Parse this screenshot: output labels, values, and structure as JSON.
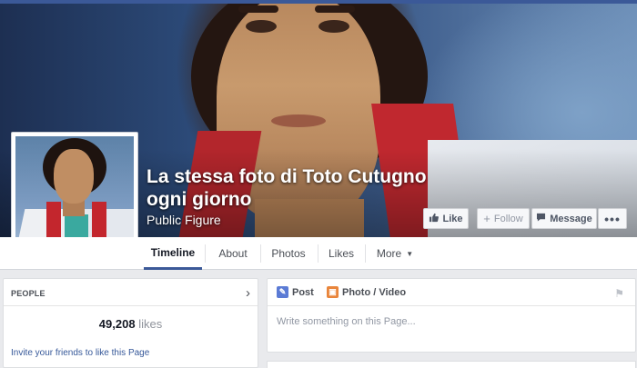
{
  "page": {
    "title": "La stessa foto di Toto Cutugno ogni giorno",
    "category": "Public Figure"
  },
  "actions": {
    "like": "Like",
    "follow": "Follow",
    "message": "Message",
    "more": "•••"
  },
  "tabs": [
    "Timeline",
    "About",
    "Photos",
    "Likes",
    "More"
  ],
  "people": {
    "title": "PEOPLE",
    "likes_count": "49,208",
    "likes_suffix": "likes",
    "invite": "Invite your friends to like this Page"
  },
  "composer": {
    "post_tab": "Post",
    "photo_tab": "Photo / Video",
    "placeholder": "Write something on this Page..."
  },
  "colors": {
    "brand": "#3b5998",
    "link": "#365899"
  },
  "icons": {
    "like": "thumbs-up-icon",
    "follow": "plus-icon",
    "message": "speech-bubble-icon",
    "people_chevron": "chevron-right-icon",
    "post": "pencil-icon",
    "photo": "photo-icon",
    "flag": "flag-icon",
    "more_dropdown": "caret-down-icon"
  }
}
